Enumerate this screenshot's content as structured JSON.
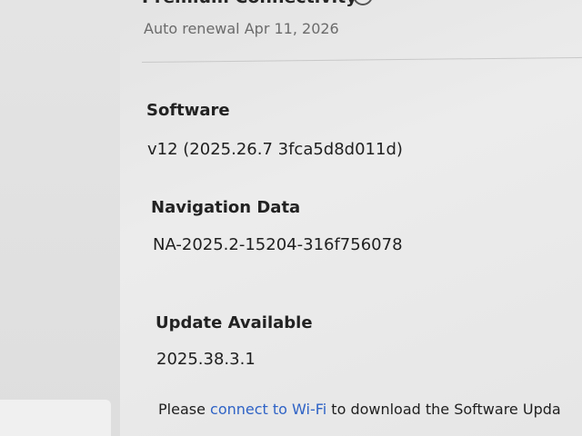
{
  "connectivity": {
    "title": "Premium Connectivity",
    "info_icon": "info-icon",
    "renewal": "Auto renewal Apr 11, 2026"
  },
  "software": {
    "label": "Software",
    "value": "v12 (2025.26.7 3fca5d8d011d)"
  },
  "navigation_data": {
    "label": "Navigation Data",
    "value": "NA-2025.2-15204-316f756078"
  },
  "update": {
    "label": "Update Available",
    "value": "2025.38.3.1"
  },
  "notice": {
    "prefix": "Please ",
    "link": "connect to Wi-Fi",
    "suffix": " to download the Software Upda"
  },
  "colors": {
    "link": "#2f63c6",
    "text": "#1f1f1f",
    "muted": "#6b6b6b"
  }
}
